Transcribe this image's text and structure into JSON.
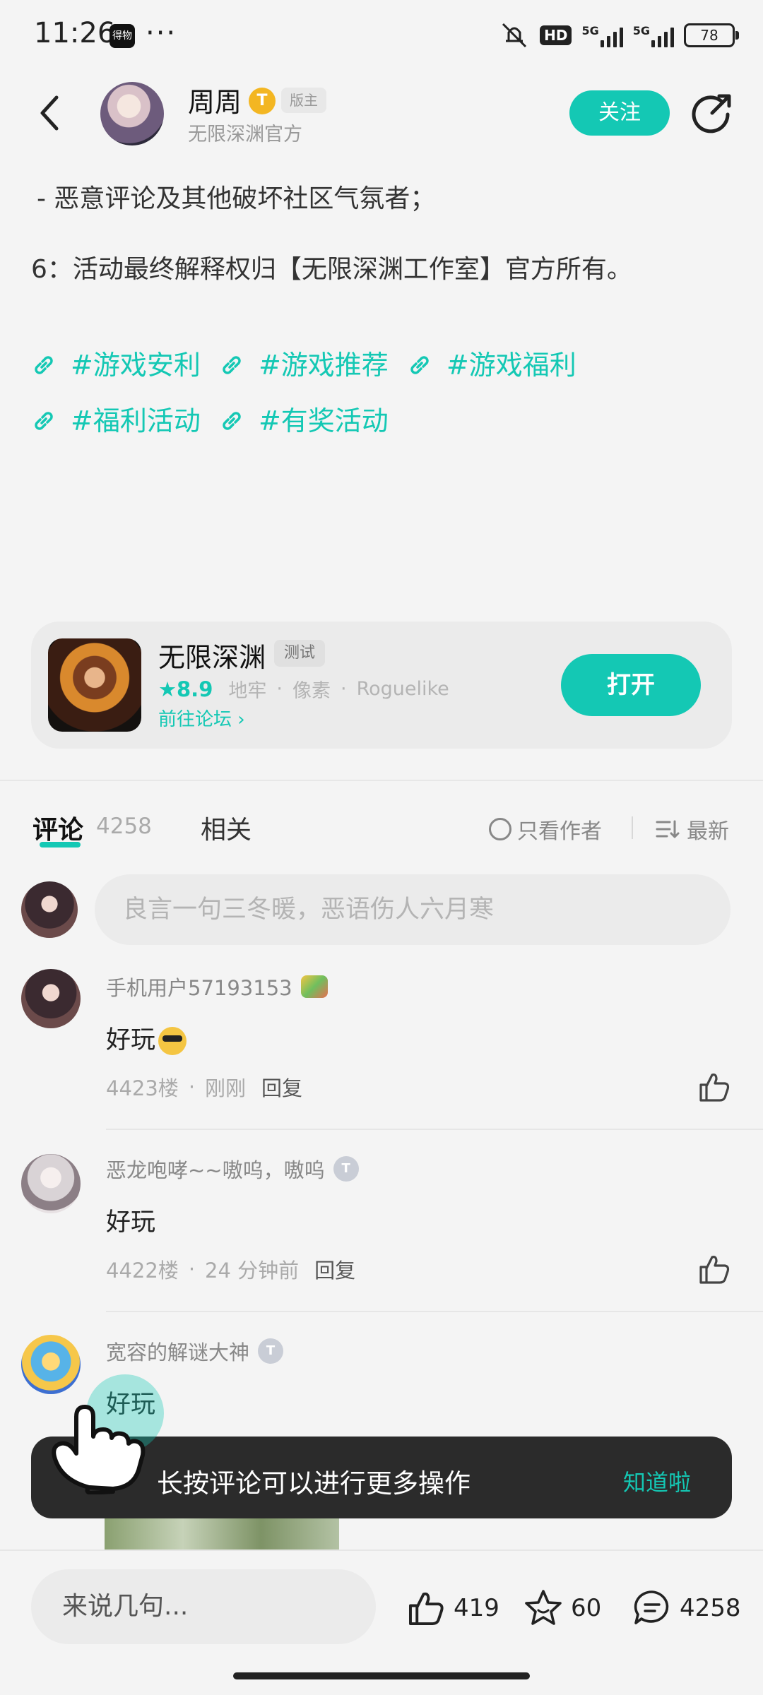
{
  "status_bar": {
    "time": "11:26",
    "app_icon_text": "得物",
    "dots": "···",
    "network_1": "5G",
    "network_2": "5G",
    "hd": "HD",
    "battery": "78"
  },
  "header": {
    "author_name": "周周",
    "author_badge": "T",
    "role_tag": "版主",
    "author_subtitle": "无限深渊官方",
    "follow_label": "关注"
  },
  "post": {
    "line_1": "- 恶意评论及其他破坏社区气氛者；",
    "line_2": "6：活动最终解释权归【无限深渊工作室】官方所有。",
    "tags": [
      "#游戏安利",
      "#游戏推荐",
      "#游戏福利",
      "#福利活动",
      "#有奖活动"
    ]
  },
  "game_card": {
    "name": "无限深渊",
    "status_tag": "测试",
    "rating": "8.9",
    "genres": [
      "地牢",
      "像素",
      "Roguelike"
    ],
    "forum_link": "前往论坛",
    "open_label": "打开"
  },
  "comments_section": {
    "tab_comments": "评论",
    "comment_count": "4258",
    "tab_related": "相关",
    "author_only": "只看作者",
    "sort_label": "最新",
    "input_placeholder": "良言一句三冬暖，恶语伤人六月寒"
  },
  "comments": [
    {
      "user": "手机用户57193153",
      "text": "好玩",
      "floor": "4423楼",
      "time": "刚刚",
      "reply": "回复"
    },
    {
      "user": "恶龙咆哮~~嗷呜，嗷呜",
      "badge": "T",
      "text": "好玩",
      "floor": "4422楼",
      "time": "24 分钟前",
      "reply": "回复"
    },
    {
      "user": "宽容的解谜大神",
      "badge": "T",
      "text": "好玩"
    }
  ],
  "toast": {
    "message": "长按评论可以进行更多操作",
    "action": "知道啦"
  },
  "bottom_bar": {
    "input_placeholder": "来说几句...",
    "likes": "419",
    "favorites": "60",
    "comments": "4258"
  },
  "colors": {
    "accent": "#14c8b4",
    "background": "#f4f4f4",
    "toast_bg": "#2b2b2b"
  }
}
